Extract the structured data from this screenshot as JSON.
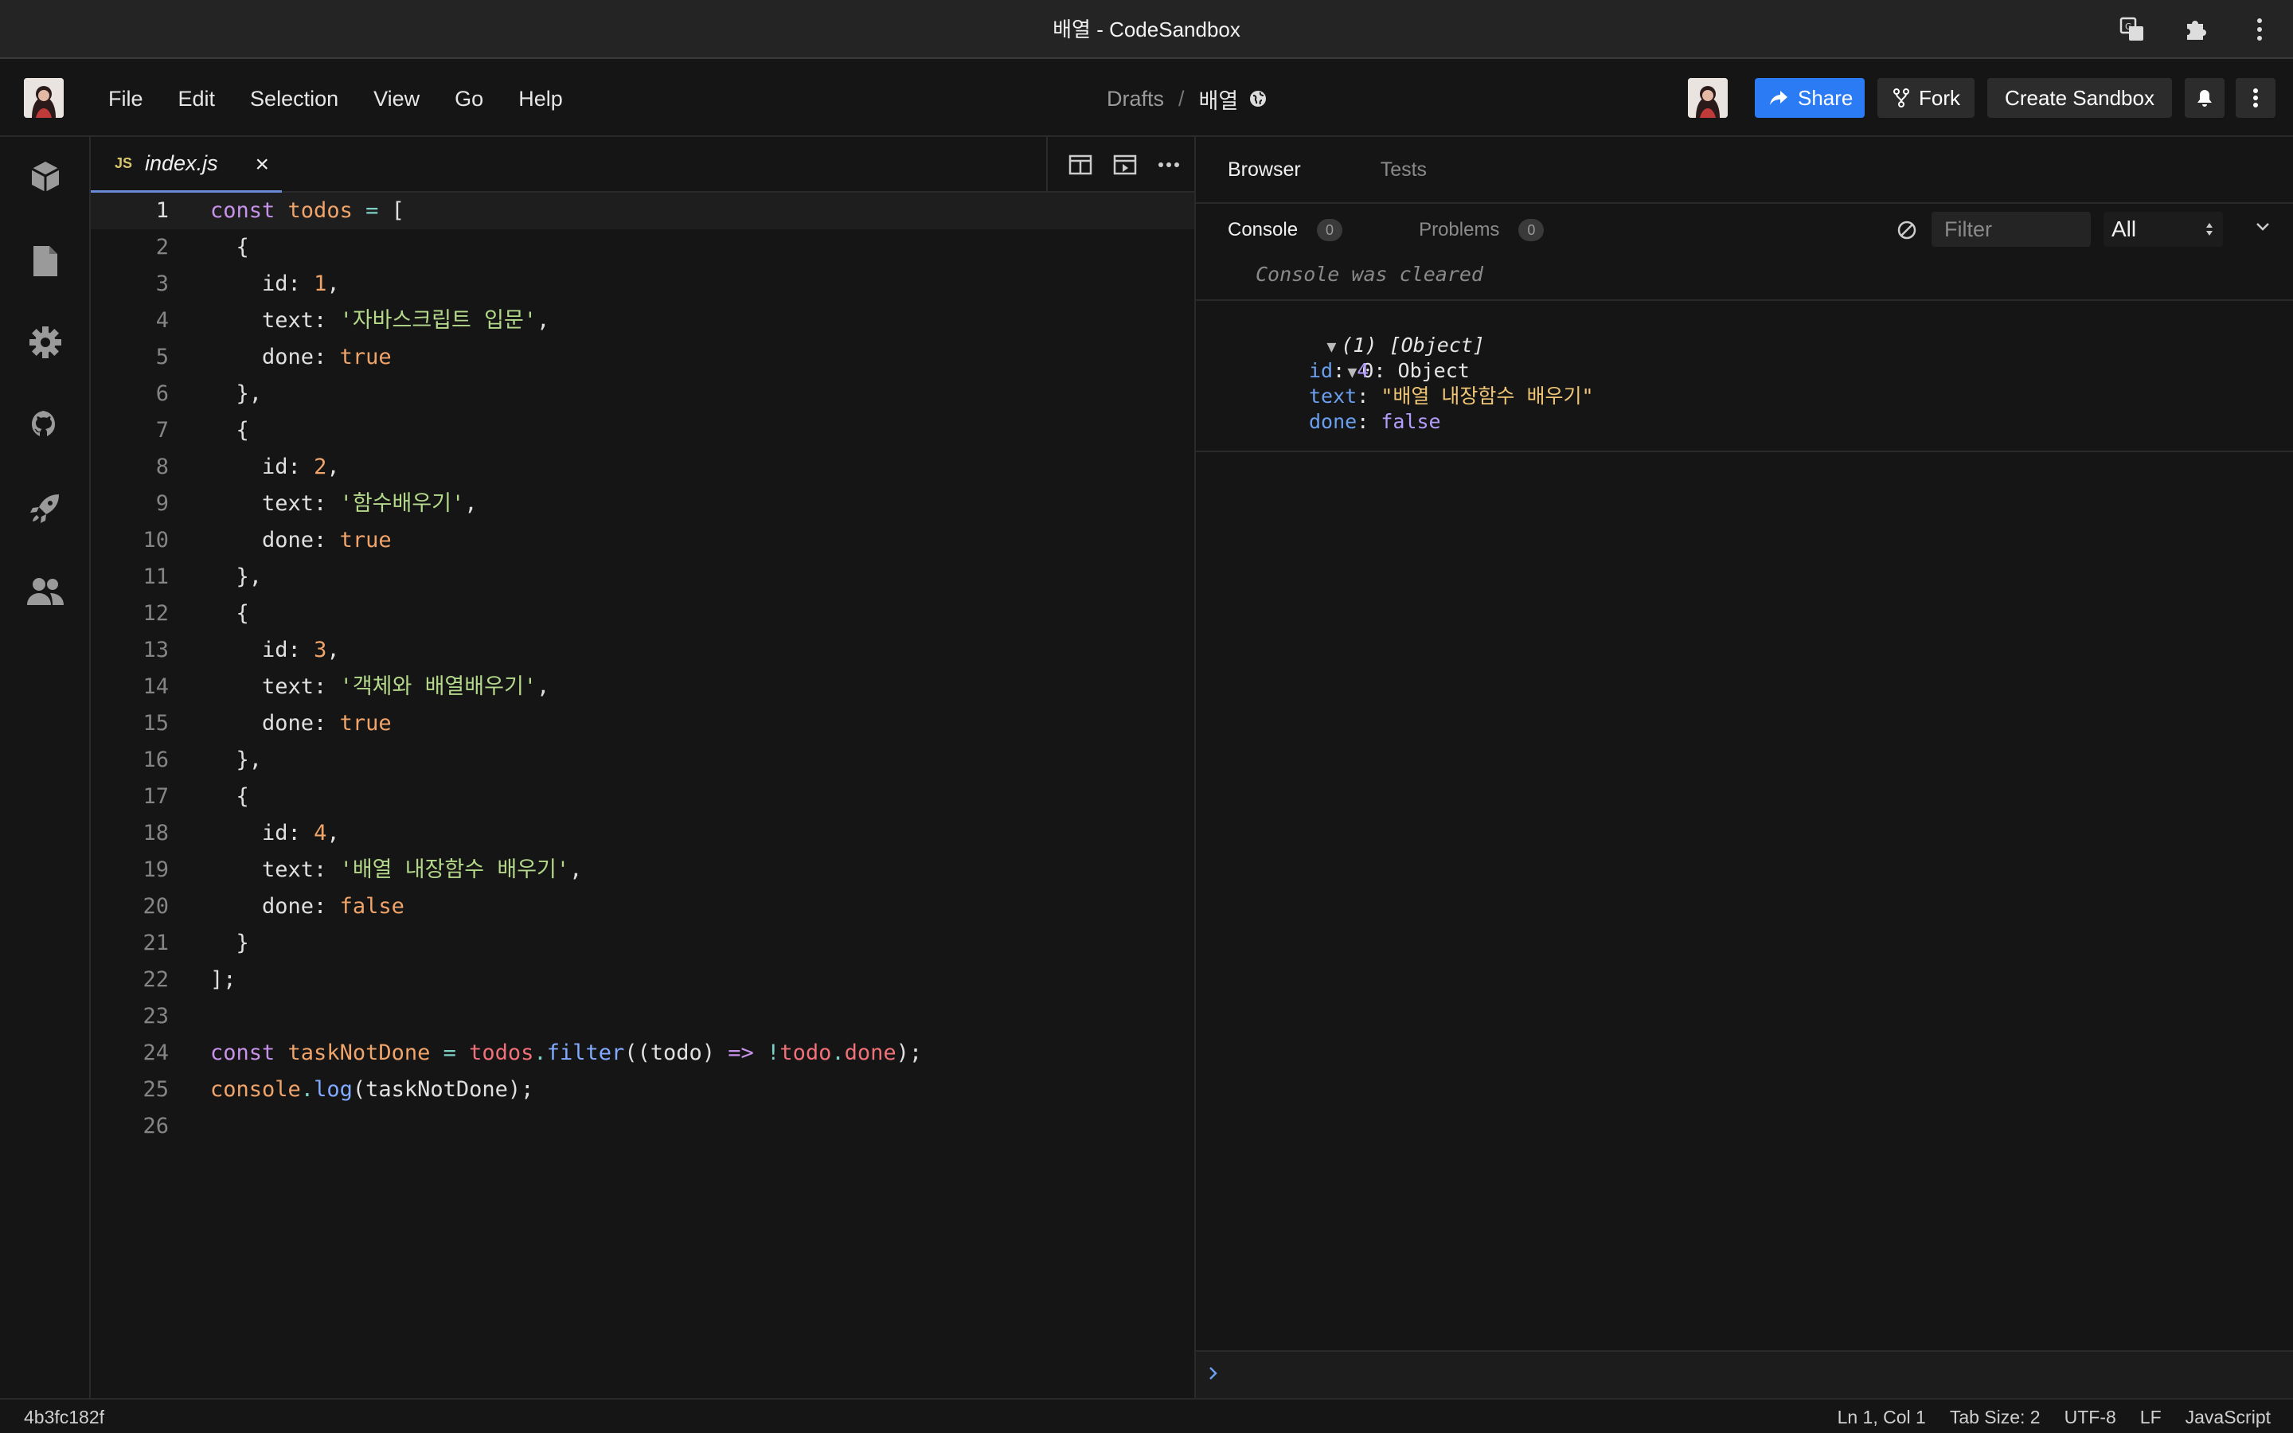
{
  "window": {
    "title": "배열 - CodeSandbox"
  },
  "menu": [
    "File",
    "Edit",
    "Selection",
    "View",
    "Go",
    "Help"
  ],
  "breadcrumb": {
    "folder": "Drafts",
    "separator": "/",
    "name": "배열"
  },
  "actions": {
    "share": "Share",
    "fork": "Fork",
    "create": "Create Sandbox"
  },
  "editor": {
    "tab": {
      "badge": "JS",
      "filename": "index.js",
      "close": "×"
    },
    "current_line": 1
  },
  "code_lines": [
    [
      [
        "k",
        "const "
      ],
      [
        "v",
        "todos"
      ],
      [
        "o",
        " = "
      ],
      [
        "p",
        "["
      ]
    ],
    [
      [
        "p",
        "  {"
      ]
    ],
    [
      [
        "pr",
        "    id"
      ],
      [
        "p",
        ": "
      ],
      [
        "n",
        "1"
      ],
      [
        "p",
        ","
      ]
    ],
    [
      [
        "pr",
        "    text"
      ],
      [
        "p",
        ": "
      ],
      [
        "s",
        "'자바스크립트 입문'"
      ],
      [
        "p",
        ","
      ]
    ],
    [
      [
        "pr",
        "    done"
      ],
      [
        "p",
        ": "
      ],
      [
        "b",
        "true"
      ]
    ],
    [
      [
        "p",
        "  },"
      ]
    ],
    [
      [
        "p",
        "  {"
      ]
    ],
    [
      [
        "pr",
        "    id"
      ],
      [
        "p",
        ": "
      ],
      [
        "n",
        "2"
      ],
      [
        "p",
        ","
      ]
    ],
    [
      [
        "pr",
        "    text"
      ],
      [
        "p",
        ": "
      ],
      [
        "s",
        "'함수배우기'"
      ],
      [
        "p",
        ","
      ]
    ],
    [
      [
        "pr",
        "    done"
      ],
      [
        "p",
        ": "
      ],
      [
        "b",
        "true"
      ]
    ],
    [
      [
        "p",
        "  },"
      ]
    ],
    [
      [
        "p",
        "  {"
      ]
    ],
    [
      [
        "pr",
        "    id"
      ],
      [
        "p",
        ": "
      ],
      [
        "n",
        "3"
      ],
      [
        "p",
        ","
      ]
    ],
    [
      [
        "pr",
        "    text"
      ],
      [
        "p",
        ": "
      ],
      [
        "s",
        "'객체와 배열배우기'"
      ],
      [
        "p",
        ","
      ]
    ],
    [
      [
        "pr",
        "    done"
      ],
      [
        "p",
        ": "
      ],
      [
        "b",
        "true"
      ]
    ],
    [
      [
        "p",
        "  },"
      ]
    ],
    [
      [
        "p",
        "  {"
      ]
    ],
    [
      [
        "pr",
        "    id"
      ],
      [
        "p",
        ": "
      ],
      [
        "n",
        "4"
      ],
      [
        "p",
        ","
      ]
    ],
    [
      [
        "pr",
        "    text"
      ],
      [
        "p",
        ": "
      ],
      [
        "s",
        "'배열 내장함수 배우기'"
      ],
      [
        "p",
        ","
      ]
    ],
    [
      [
        "pr",
        "    done"
      ],
      [
        "p",
        ": "
      ],
      [
        "b",
        "false"
      ]
    ],
    [
      [
        "p",
        "  }"
      ]
    ],
    [
      [
        "p",
        "];"
      ]
    ],
    [],
    [
      [
        "k",
        "const "
      ],
      [
        "v",
        "taskNotDone"
      ],
      [
        "o",
        " = "
      ],
      [
        "r",
        "todos"
      ],
      [
        "o",
        "."
      ],
      [
        "f",
        "filter"
      ],
      [
        "p",
        "((todo) "
      ],
      [
        "k",
        "=>"
      ],
      [
        "p",
        " "
      ],
      [
        "o",
        "!"
      ],
      [
        "r",
        "todo"
      ],
      [
        "o",
        "."
      ],
      [
        "r",
        "done"
      ],
      [
        "p",
        ");"
      ]
    ],
    [
      [
        "v",
        "console"
      ],
      [
        "o",
        "."
      ],
      [
        "f",
        "log"
      ],
      [
        "p",
        "(taskNotDone);"
      ]
    ],
    []
  ],
  "browser_tabs": [
    "Browser",
    "Tests"
  ],
  "console": {
    "tabs": [
      {
        "label": "Console",
        "count": "0"
      },
      {
        "label": "Problems",
        "count": "0"
      }
    ],
    "filter_placeholder": "Filter",
    "level": "All",
    "cleared": "Console was cleared",
    "summary": "(1) [Object]",
    "item_label": "0: Object",
    "props": [
      {
        "key": "id",
        "value": "4",
        "color": "#b39dfa"
      },
      {
        "key": "text",
        "value": "\"배열 내장함수 배우기\"",
        "color": "#f0c674"
      },
      {
        "key": "done",
        "value": "false",
        "color": "#b39dfa"
      }
    ]
  },
  "status": {
    "hash": "4b3fc182f",
    "position": "Ln 1, Col 1",
    "tab_size": "Tab Size: 2",
    "encoding": "UTF-8",
    "eol": "LF",
    "language": "JavaScript"
  },
  "colors": {
    "accent": "#2a7bf4",
    "tab_underline": "#6b8bd9"
  }
}
